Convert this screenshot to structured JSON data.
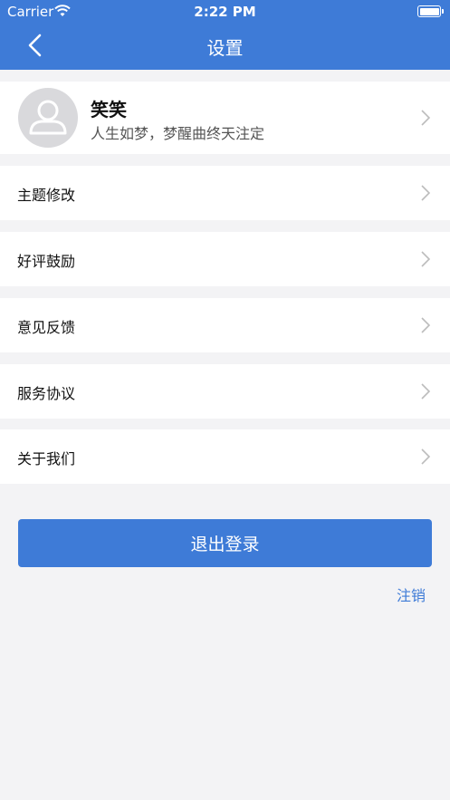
{
  "status_bar": {
    "carrier": "Carrier",
    "time": "2:22 PM"
  },
  "nav": {
    "title": "设置",
    "back_icon": "chevron-left-icon"
  },
  "profile": {
    "name": "笑笑",
    "motto": "人生如梦，梦醒曲终天注定",
    "avatar_icon": "user-avatar-icon"
  },
  "menu": [
    {
      "label": "主题修改"
    },
    {
      "label": "好评鼓励"
    },
    {
      "label": "意见反馈"
    },
    {
      "label": "服务协议"
    },
    {
      "label": "关于我们"
    }
  ],
  "logout_label": "退出登录",
  "cancel_label": "注销",
  "colors": {
    "accent": "#3e7bd7",
    "background": "#f3f3f5"
  }
}
